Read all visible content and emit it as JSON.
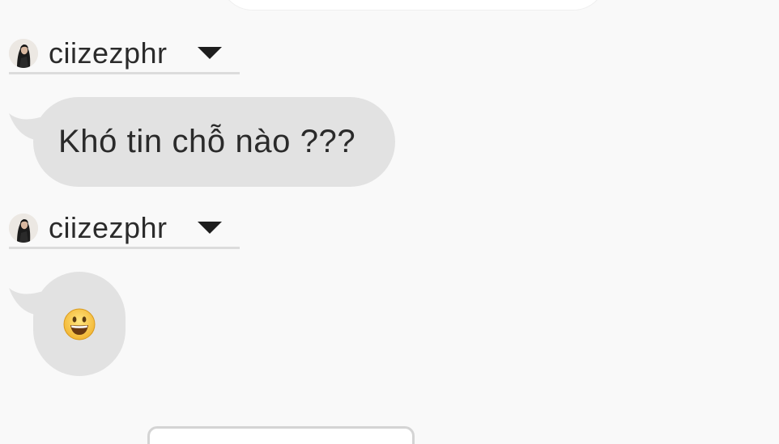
{
  "messages": [
    {
      "sender": {
        "name": "ciizezphr",
        "avatar_icon": "user-photo-avatar"
      },
      "body": "Khó tin chỗ nào ???"
    },
    {
      "sender": {
        "name": "ciizezphr",
        "avatar_icon": "user-photo-avatar"
      },
      "body_icon": "smiling-face-emoji"
    }
  ],
  "colors": {
    "background": "#f9f9f9",
    "bubble": "#e2e2e2",
    "divider": "#dcdcdc",
    "text": "#2a2a2a"
  }
}
